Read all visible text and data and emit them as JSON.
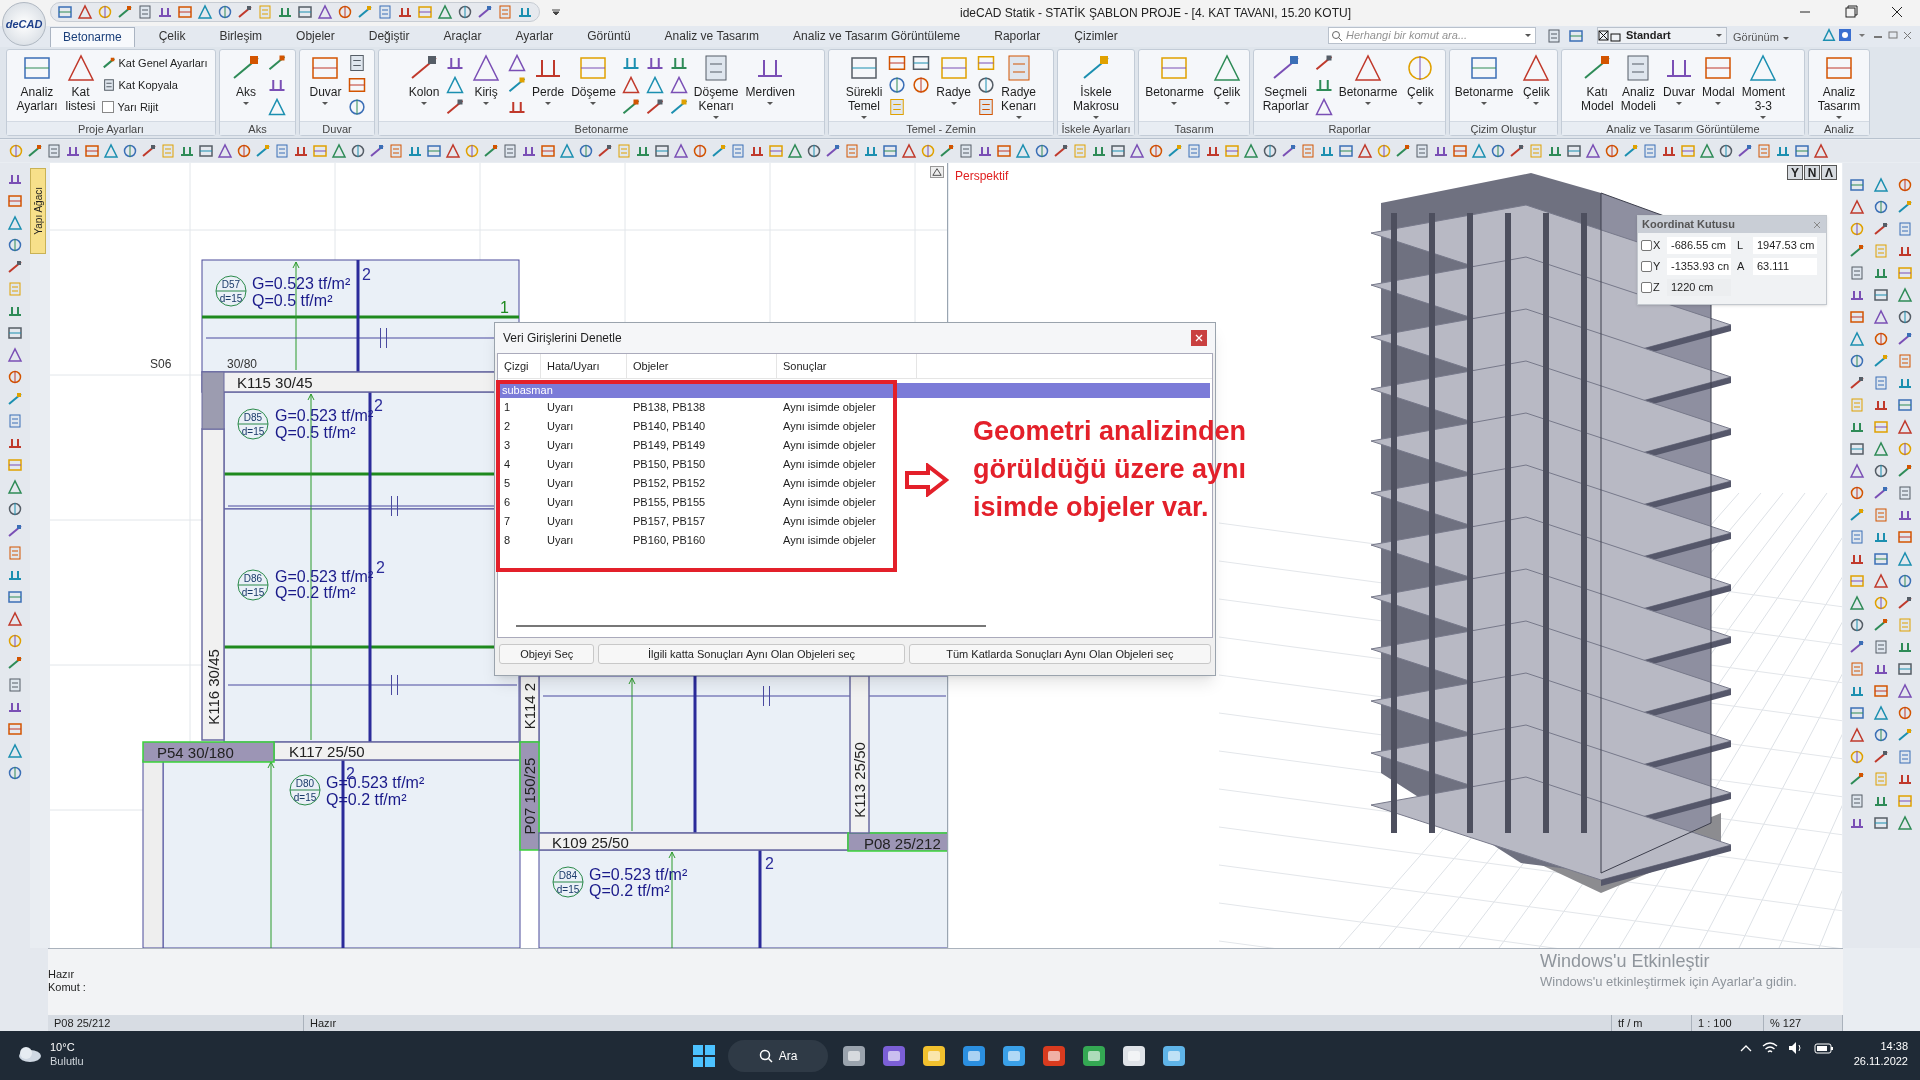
{
  "window": {
    "logo": "deCAD",
    "title": "ideCAD Statik - STATİK ŞABLON PROJE - [4. KAT TAVANI, 15.20 KOTU]"
  },
  "tabs": [
    {
      "label": "Betonarme",
      "selected": true
    },
    {
      "label": "Çelik",
      "selected": false
    },
    {
      "label": "Birleşim",
      "selected": false
    },
    {
      "label": "Objeler",
      "selected": false
    },
    {
      "label": "Değiştir",
      "selected": false
    },
    {
      "label": "Araçlar",
      "selected": false
    },
    {
      "label": "Ayarlar",
      "selected": false
    },
    {
      "label": "Görüntü",
      "selected": false
    },
    {
      "label": "Analiz ve Tasarım",
      "selected": false
    },
    {
      "label": "Analiz ve Tasarım Görüntüleme",
      "selected": false
    },
    {
      "label": "Raporlar",
      "selected": false
    },
    {
      "label": "Çizimler",
      "selected": false
    }
  ],
  "command_search": {
    "placeholder": "Herhangi bir komut ara..."
  },
  "style_select": {
    "value": "Standart"
  },
  "view_menu": {
    "label": "Görünüm"
  },
  "ribbon": {
    "groups": [
      {
        "label": "Proje Ayarları",
        "items": [
          {
            "kind": "large",
            "label": "Analiz Ayarları",
            "menu": false
          },
          {
            "kind": "large",
            "label": "Kat listesi",
            "menu": false
          },
          {
            "kind": "small",
            "label": "Kat Genel Ayarları"
          },
          {
            "kind": "small",
            "label": "Kat Kopyala"
          },
          {
            "kind": "checkbox",
            "label": "Yarı Rijit",
            "checked": false
          }
        ]
      },
      {
        "label": "Aks",
        "items": [
          {
            "kind": "large",
            "label": "Aks",
            "menu": true
          },
          {
            "kind": "icon"
          },
          {
            "kind": "icon"
          },
          {
            "kind": "icon"
          }
        ]
      },
      {
        "label": "Duvar",
        "items": [
          {
            "kind": "large",
            "label": "Duvar",
            "menu": true
          },
          {
            "kind": "icon"
          },
          {
            "kind": "icon"
          },
          {
            "kind": "icon"
          }
        ]
      },
      {
        "label": "Betonarme",
        "items": [
          {
            "kind": "large",
            "label": "Kolon",
            "menu": true
          },
          {
            "kind": "icon"
          },
          {
            "kind": "icon"
          },
          {
            "kind": "icon"
          },
          {
            "kind": "large",
            "label": "Kiriş",
            "menu": true
          },
          {
            "kind": "icon"
          },
          {
            "kind": "icon"
          },
          {
            "kind": "icon"
          },
          {
            "kind": "large",
            "label": "Perde",
            "menu": true
          },
          {
            "kind": "large",
            "label": "Döşeme",
            "menu": true
          },
          {
            "kind": "icon"
          },
          {
            "kind": "icon"
          },
          {
            "kind": "icon"
          },
          {
            "kind": "icon"
          },
          {
            "kind": "icon"
          },
          {
            "kind": "icon"
          },
          {
            "kind": "icon"
          },
          {
            "kind": "icon"
          },
          {
            "kind": "icon"
          },
          {
            "kind": "large",
            "label": "Döşeme Kenarı",
            "menu": true
          },
          {
            "kind": "large",
            "label": "Merdiven",
            "menu": true
          }
        ]
      },
      {
        "label": "Temel - Zemin",
        "items": [
          {
            "kind": "large",
            "label": "Sürekli Temel",
            "menu": true
          },
          {
            "kind": "icon"
          },
          {
            "kind": "icon"
          },
          {
            "kind": "icon"
          },
          {
            "kind": "icon"
          },
          {
            "kind": "icon"
          },
          {
            "kind": "large",
            "label": "Radye",
            "menu": true
          },
          {
            "kind": "icon"
          },
          {
            "kind": "icon"
          },
          {
            "kind": "icon"
          },
          {
            "kind": "large",
            "label": "Radye Kenarı",
            "menu": true
          }
        ]
      },
      {
        "label": "İskele Ayarları",
        "items": [
          {
            "kind": "large",
            "label": "İskele Makrosu",
            "menu": true
          }
        ]
      },
      {
        "label": "Tasarım",
        "items": [
          {
            "kind": "large",
            "label": "Betonarme",
            "menu": true
          },
          {
            "kind": "large",
            "label": "Çelik",
            "menu": true
          }
        ]
      },
      {
        "label": "Raporlar",
        "items": [
          {
            "kind": "large",
            "label": "Seçmeli Raporlar",
            "menu": false
          },
          {
            "kind": "icon"
          },
          {
            "kind": "icon"
          },
          {
            "kind": "icon"
          },
          {
            "kind": "large",
            "label": "Betonarme",
            "menu": true
          },
          {
            "kind": "large",
            "label": "Çelik",
            "menu": true
          }
        ]
      },
      {
        "label": "Çizim Oluştur",
        "items": [
          {
            "kind": "large",
            "label": "Betonarme",
            "menu": true
          },
          {
            "kind": "large",
            "label": "Çelik",
            "menu": true
          }
        ]
      },
      {
        "label": "Analiz ve Tasarım Görüntüleme",
        "items": [
          {
            "kind": "large",
            "label": "Katı Model",
            "menu": false
          },
          {
            "kind": "large",
            "label": "Analiz Modeli",
            "menu": false
          },
          {
            "kind": "large",
            "label": "Duvar",
            "menu": true
          },
          {
            "kind": "large",
            "label": "Modal",
            "menu": true
          },
          {
            "kind": "large",
            "label": "Moment 3-3",
            "menu": true
          }
        ]
      },
      {
        "label": "Analiz",
        "items": [
          {
            "kind": "large",
            "label": "Analiz Tasarım",
            "menu": true
          }
        ]
      }
    ]
  },
  "side_tab": {
    "label": "Yapı Ağacı"
  },
  "plan": {
    "axis_label": "S06",
    "note": "30/80",
    "slabs": [
      {
        "name": "D57",
        "thickness": "d=15",
        "g": "G=0.523 tf/m²",
        "q": "Q=0.5 tf/m²"
      },
      {
        "name": "D85",
        "thickness": "d=15",
        "g": "G=0.523 tf/m²",
        "q": "Q=0.5 tf/m²"
      },
      {
        "name": "D86",
        "thickness": "d=15",
        "g": "G=0.523 tf/m²",
        "q": "Q=0.2 tf/m²"
      },
      {
        "name": "D80",
        "thickness": "d=15",
        "g": "G=0.523 tf/m²",
        "q": "Q=0.2 tf/m²"
      },
      {
        "name": "D84",
        "thickness": "d=15",
        "g": "G=0.523 tf/m²",
        "q": "Q=0.2 tf/m²"
      }
    ],
    "members": [
      {
        "kind": "beam",
        "label": "K115 30/45"
      },
      {
        "kind": "beam",
        "label": "K116 30/45"
      },
      {
        "kind": "beam",
        "label": "K117 25/50"
      },
      {
        "kind": "column",
        "label": "P54 30/180"
      },
      {
        "kind": "beam",
        "label": "K114 2"
      },
      {
        "kind": "column",
        "label": "P07 150/25"
      },
      {
        "kind": "beam",
        "label": "K109 25/50"
      },
      {
        "kind": "column",
        "label": "P08 25/212"
      },
      {
        "kind": "beam",
        "label": "K113 25/50"
      }
    ],
    "marks": [
      "2",
      "2",
      "2",
      "2",
      "2",
      "1"
    ]
  },
  "perspective": {
    "label": "Perspektif",
    "view_buttons": [
      "Y",
      "N",
      "Λ"
    ]
  },
  "coordinate_box": {
    "title": "Koordinat Kutusu",
    "rows": [
      {
        "axis": "X",
        "checked": false,
        "value": "-686.55 cm",
        "extra_label": "L",
        "extra_value": "1947.53 cm"
      },
      {
        "axis": "Y",
        "checked": false,
        "value": "-1353.93 cn",
        "extra_label": "A",
        "extra_value": "63.111"
      },
      {
        "axis": "Z",
        "checked": false,
        "value": "1220 cm"
      }
    ]
  },
  "dialog": {
    "title": "Veri Girişlerini Denetle",
    "columns": [
      "Çizgi",
      "Hata/Uyarı",
      "Objeler",
      "Sonuçlar"
    ],
    "group": "subasman",
    "rows": [
      {
        "line": "1",
        "type": "Uyarı",
        "objects": "PB138, PB138",
        "result": "Aynı isimde objeler"
      },
      {
        "line": "2",
        "type": "Uyarı",
        "objects": "PB140, PB140",
        "result": "Aynı isimde objeler"
      },
      {
        "line": "3",
        "type": "Uyarı",
        "objects": "PB149, PB149",
        "result": "Aynı isimde objeler"
      },
      {
        "line": "4",
        "type": "Uyarı",
        "objects": "PB150, PB150",
        "result": "Aynı isimde objeler"
      },
      {
        "line": "5",
        "type": "Uyarı",
        "objects": "PB152, PB152",
        "result": "Aynı isimde objeler"
      },
      {
        "line": "6",
        "type": "Uyarı",
        "objects": "PB155, PB155",
        "result": "Aynı isimde objeler"
      },
      {
        "line": "7",
        "type": "Uyarı",
        "objects": "PB157, PB157",
        "result": "Aynı isimde objeler"
      },
      {
        "line": "8",
        "type": "Uyarı",
        "objects": "PB160, PB160",
        "result": "Aynı isimde objeler"
      }
    ],
    "buttons": [
      "Objeyi Seç",
      "İlgili katta Sonuçları Aynı Olan Objeleri seç",
      "Tüm Katlarda Sonuçları Aynı Olan Objeleri seç"
    ]
  },
  "annotation": {
    "text": "Geometri analizinden görüldüğü üzere aynı isimde objeler var."
  },
  "activation_notice": {
    "title": "Windows'u Etkinleştir",
    "text": "Windows'u etkinleştirmek için Ayarlar'a gidin."
  },
  "command_area": {
    "status": "Hazır",
    "prompt": "Komut :"
  },
  "status_bar": {
    "object": "P08 25/212",
    "state": "Hazır",
    "unit": "tf / m",
    "scale": "1 : 100",
    "zoom": "% 127"
  },
  "taskbar": {
    "temperature": "10°C",
    "weather": "Bulutlu",
    "search": "Ara",
    "time": "14:38",
    "date": "26.11.2022"
  }
}
